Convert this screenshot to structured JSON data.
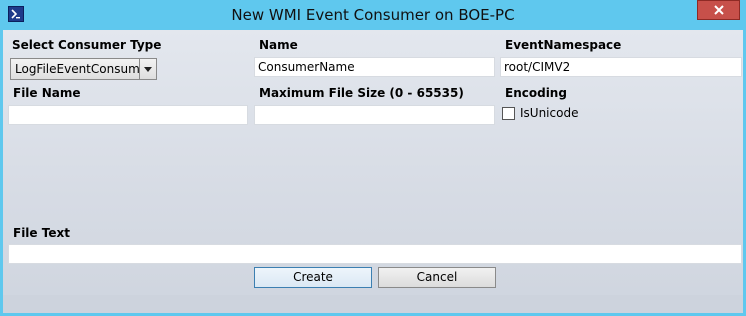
{
  "window": {
    "title": "New WMI Event Consumer on BOE-PC",
    "app_icon": "powershell-icon",
    "close_icon": "close-icon",
    "colors": {
      "titlebar": "#5fc8ee",
      "close": "#c7504a",
      "client": "#dfe3ea"
    }
  },
  "form": {
    "consumer_type": {
      "label": "Select Consumer Type",
      "selected": "LogFileEventConsumer"
    },
    "name": {
      "label": "Name",
      "value": "ConsumerName"
    },
    "event_namespace": {
      "label": "EventNamespace",
      "value": "root/CIMV2"
    },
    "file_name": {
      "label": "File Name",
      "value": ""
    },
    "max_file_size": {
      "label": "Maximum File Size (0 - 65535)",
      "value": ""
    },
    "encoding": {
      "label": "Encoding",
      "checkbox_label": "IsUnicode",
      "checked": false
    },
    "file_text": {
      "label": "File Text",
      "value": ""
    }
  },
  "buttons": {
    "create": "Create",
    "cancel": "Cancel"
  }
}
